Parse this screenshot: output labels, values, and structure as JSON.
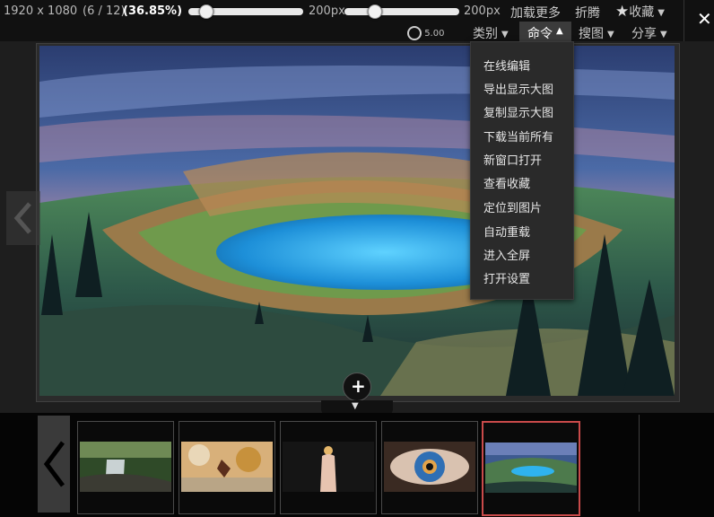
{
  "topbar": {
    "resolution": "1920 x 1080",
    "index": "(6 / 12)",
    "zoom": "(36.85%)",
    "slider1_label": "200px",
    "slider2_label": "200px",
    "load_more": "加载更多",
    "fold": "折腾",
    "favorite": "收藏",
    "rating": "5.00",
    "category": "类别",
    "command": "命令",
    "search_image": "搜图",
    "share": "分享"
  },
  "command_menu": {
    "items": [
      "在线编辑",
      "导出显示大图",
      "复制显示大图",
      "下载当前所有",
      "新窗口打开",
      "查看收藏",
      "定位到图片",
      "自动重载",
      "进入全屏",
      "打开设置"
    ]
  },
  "filmstrip": {
    "thumbnails": [
      {
        "subject": "forest waterfall"
      },
      {
        "subject": "autumn leaves"
      },
      {
        "subject": "woman figure"
      },
      {
        "subject": "eye close-up"
      },
      {
        "subject": "crater lake landscape",
        "active": true
      }
    ]
  },
  "icons": {
    "close": "close-icon",
    "star": "star-icon",
    "rating": "rating-circle-icon",
    "prev": "chevron-left-icon",
    "add": "plus-icon",
    "toggle": "triangle-down-icon"
  },
  "colors": {
    "topbar_bg": "#111111",
    "active_thumb_border": "#c94a4a",
    "menu_bg": "#2a2a2a"
  }
}
